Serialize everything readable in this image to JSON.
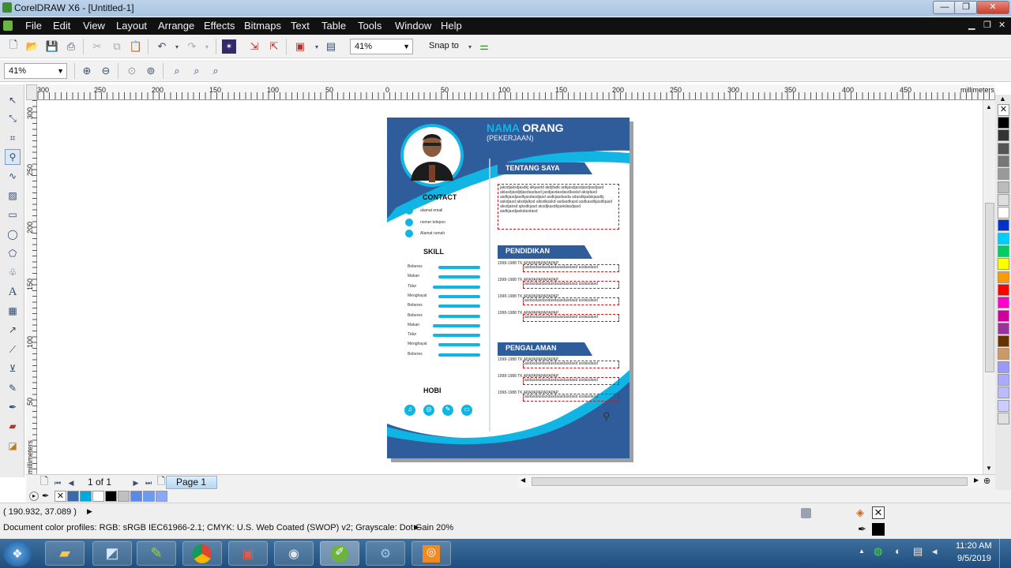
{
  "window": {
    "title": "CorelDRAW X6 - [Untitled-1]"
  },
  "menu": [
    "File",
    "Edit",
    "View",
    "Layout",
    "Arrange",
    "Effects",
    "Bitmaps",
    "Text",
    "Table",
    "Tools",
    "Window",
    "Help"
  ],
  "toolbar": {
    "zoom": "41%",
    "snap_to": "Snap to"
  },
  "ruler": {
    "h": [
      "300",
      "250",
      "200",
      "150",
      "100",
      "50",
      "0",
      "50",
      "100",
      "150",
      "200",
      "250",
      "300",
      "350",
      "400",
      "450"
    ],
    "v": [
      "300",
      "250",
      "200",
      "150",
      "100",
      "50"
    ],
    "units": "millimeters"
  },
  "resume": {
    "name_first": "NAMA",
    "name_last": "ORANG",
    "job": "(PEKERJAAN)",
    "sections": [
      "TENTANG SAYA",
      "PENDIDIKAN",
      "PENGALAMAN"
    ],
    "about": "jaksdjaksdjasdkj alkjasdd akdjfadk adkjasdjasdjasdjasdjasd aklasdjasdjdjasdasdasd jasdjasdasdasdkaskd aksjdasd asdkjasdjasdkjasdasdjasd asdkjasdasda sdasdkjadskjasdkj askdjasd aksdjalksd alksdkaskd asdasdkasd asdkasdkjasdkjasd aksdjaksd ajksdkjasd aksdjkasdkjaskdasdjasd asdkjasdjaskdasdasd",
    "contact_heading": "CONTACT",
    "contact": [
      "alamat email",
      "nomer telepon",
      "Alamat rumah"
    ],
    "skill_heading": "SKILL",
    "skills": [
      {
        "label": "Beberes",
        "level": 0.75
      },
      {
        "label": "Makan",
        "level": 0.75
      },
      {
        "label": "Tidur",
        "level": 0.85
      },
      {
        "label": "Menghayal",
        "level": 0.75
      },
      {
        "label": "Beberes",
        "level": 0.75
      },
      {
        "label": "Beberes",
        "level": 0.75
      },
      {
        "label": "Makan",
        "level": 0.85
      },
      {
        "label": "Tidur",
        "level": 0.85
      },
      {
        "label": "Menghayal",
        "level": 0.75
      },
      {
        "label": "Beberes",
        "level": 0.75
      }
    ],
    "hobi_heading": "HOBI",
    "education": [
      {
        "years": "1998-1988",
        "title": "TK APAPAPAPAPAPAP",
        "desc": "asdasdasdasdasdaasdasdasd asdasdasd"
      },
      {
        "years": "1998-1988",
        "title": "TK APAPAPAPAPAPAP",
        "desc": "asdasdasdasdasdaasdasdasd asdasdasd"
      },
      {
        "years": "1998-1988",
        "title": "TK APAPAPAPAPAPAP",
        "desc": "asdasdasdasdasdaasdasdasd asdasdasd"
      },
      {
        "years": "1998-1988",
        "title": "TK APAPAPAPAPAPAP",
        "desc": "asdasdasdasdasdaasdasdasd asdasdasd"
      }
    ],
    "experience": [
      {
        "years": "1998-1988",
        "title": "TK APAPAPAPAPAPAP",
        "desc": "asdasdasdasdasdaasdasdasd asdasdasd"
      },
      {
        "years": "1998-1988",
        "title": "TK APAPAPAPAPAPAP",
        "desc": "asdasdasdasdasdaasdasdasd asdasdasd"
      },
      {
        "years": "1998-1988",
        "title": "TK APAPAPAPAPAPAP",
        "desc": "asdasdasdasdasdaasdasdasd asdasdasd"
      }
    ]
  },
  "palette": [
    "#000000",
    "#333333",
    "#555555",
    "#777777",
    "#999999",
    "#bbbbbb",
    "#dddddd",
    "#ffffff",
    "#0033cc",
    "#00ccff",
    "#00cc66",
    "#ffff00",
    "#ff9900",
    "#ff0000",
    "#ff00cc",
    "#cc0099",
    "#993399",
    "#663300",
    "#cc9966",
    "#9999ff",
    "#aaaaff",
    "#bbbbff",
    "#ccccff",
    "#e0e0e0"
  ],
  "doc_palette": [
    "#3a6aa8",
    "#00a8e0",
    "#ffffff",
    "#000000",
    "#c0c0c0",
    "#5a8ae6",
    "#6b9bf0",
    "#8aa8f5"
  ],
  "navigator": {
    "counter": "1 of 1",
    "page_tab": "Page 1"
  },
  "status": {
    "coords": "( 190.932, 37.089 )",
    "profiles": "Document color profiles: RGB: sRGB IEC61966-2.1; CMYK: U.S. Web Coated (SWOP) v2; Grayscale: Dot Gain 20%"
  },
  "taskbar": {
    "time": "11:20 AM",
    "date": "9/5/2019"
  }
}
